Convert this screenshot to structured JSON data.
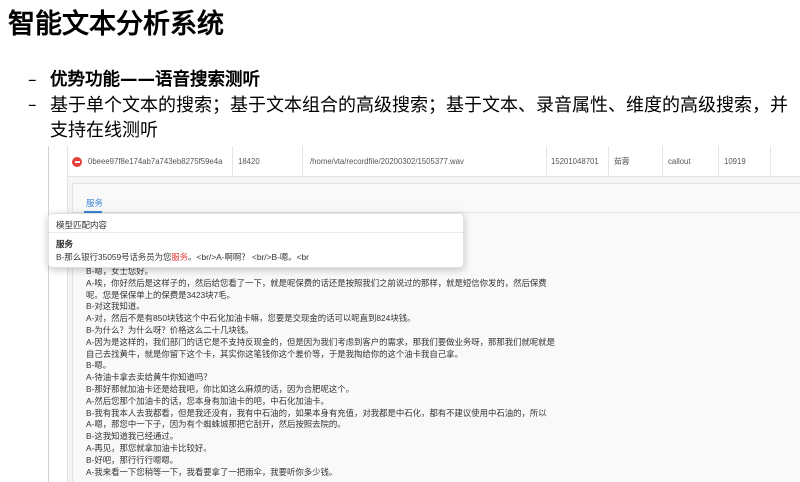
{
  "slide": {
    "title": "智能文本分析系统",
    "bullets": [
      {
        "marker": "–",
        "text": "优势功能——语音搜索测听"
      },
      {
        "marker": "–",
        "text": "基于单个文本的搜索；基于文本组合的高级搜索；基于文本、录音属性、维度的高级搜索，并支持在线测听"
      }
    ]
  },
  "record_table": {
    "row": {
      "toggle_icon": "minus-circle-icon",
      "cells": [
        "0beee97f8e174ab7a743eb8275f59e4a",
        "18420",
        "/home/vta/recordfile/20200302/1505377.wav",
        "15201048701",
        "茹蓉",
        "callout",
        "10919"
      ]
    }
  },
  "detail_panel": {
    "tabs": [
      {
        "label": "服务",
        "active": true
      }
    ],
    "match_popup": {
      "header": "模型匹配内容",
      "keyword": "服务",
      "snippet": {
        "before": "B-那么银行35059号话务员为您",
        "highlight": "服务",
        "after": "。<br/>A-啊啊？ <br/>B-嗯。<br"
      }
    },
    "transcript_lines": [
      "B-嗯，女士您好。",
      "A-唉，你好然后是这样子的，然后给您看了一下，就是呢保费的话还是按照我们之前说过的那样，就是短信你发的，然后保费",
      "呢。您是保保单上的保费是3423块7毛。",
      "B-对这我知道。",
      "A-对，然后不是有850块钱这个中石化加油卡嘛，您要是交现金的话可以呢直到824块钱。",
      "B-为什么？为什么呀？价格这么二十几块钱。",
      "A-因为是这样的，我们部门的话它是不支持反现金的，但是因为我们考虑到客户的需求，那我们要做业务呀，那那我们就呢就是",
      "自己去找黄牛，就是你留下这个卡，其实你这笔钱你这个差价等，于是我掏给你的这个油卡我自己拿。",
      "B-嗯。",
      "A-待油卡拿去卖给黄牛你知道吗？",
      "B-那好那就加油卡还是给我吧，你比如这么麻烦的话，因为合肥呢这个。",
      "A-然后您那个加油卡的话，您本身有加油卡的吧，中石化加油卡。",
      "B-我有我本人去我都看，但是我还没有，我有中石油的，如果本身有充值，对我都是中石化，都有不建议使用中石油的，所以",
      "A-嗯，那您中一下子，因为有个蜘蛛城那把它刮开，然后按照去院的。",
      "B-这我知道我已经通过。",
      "A-再见，那您就拿加油卡比较好。",
      "B-好吧，那行行行嗯嗯。",
      "A-我来看一下您稍等一下，我看要拿了一把雨伞，我要听你多少钱。"
    ]
  },
  "colors": {
    "link": "#3a86d6",
    "highlight": "#e5403a",
    "toggle_icon": "#e5403a"
  }
}
